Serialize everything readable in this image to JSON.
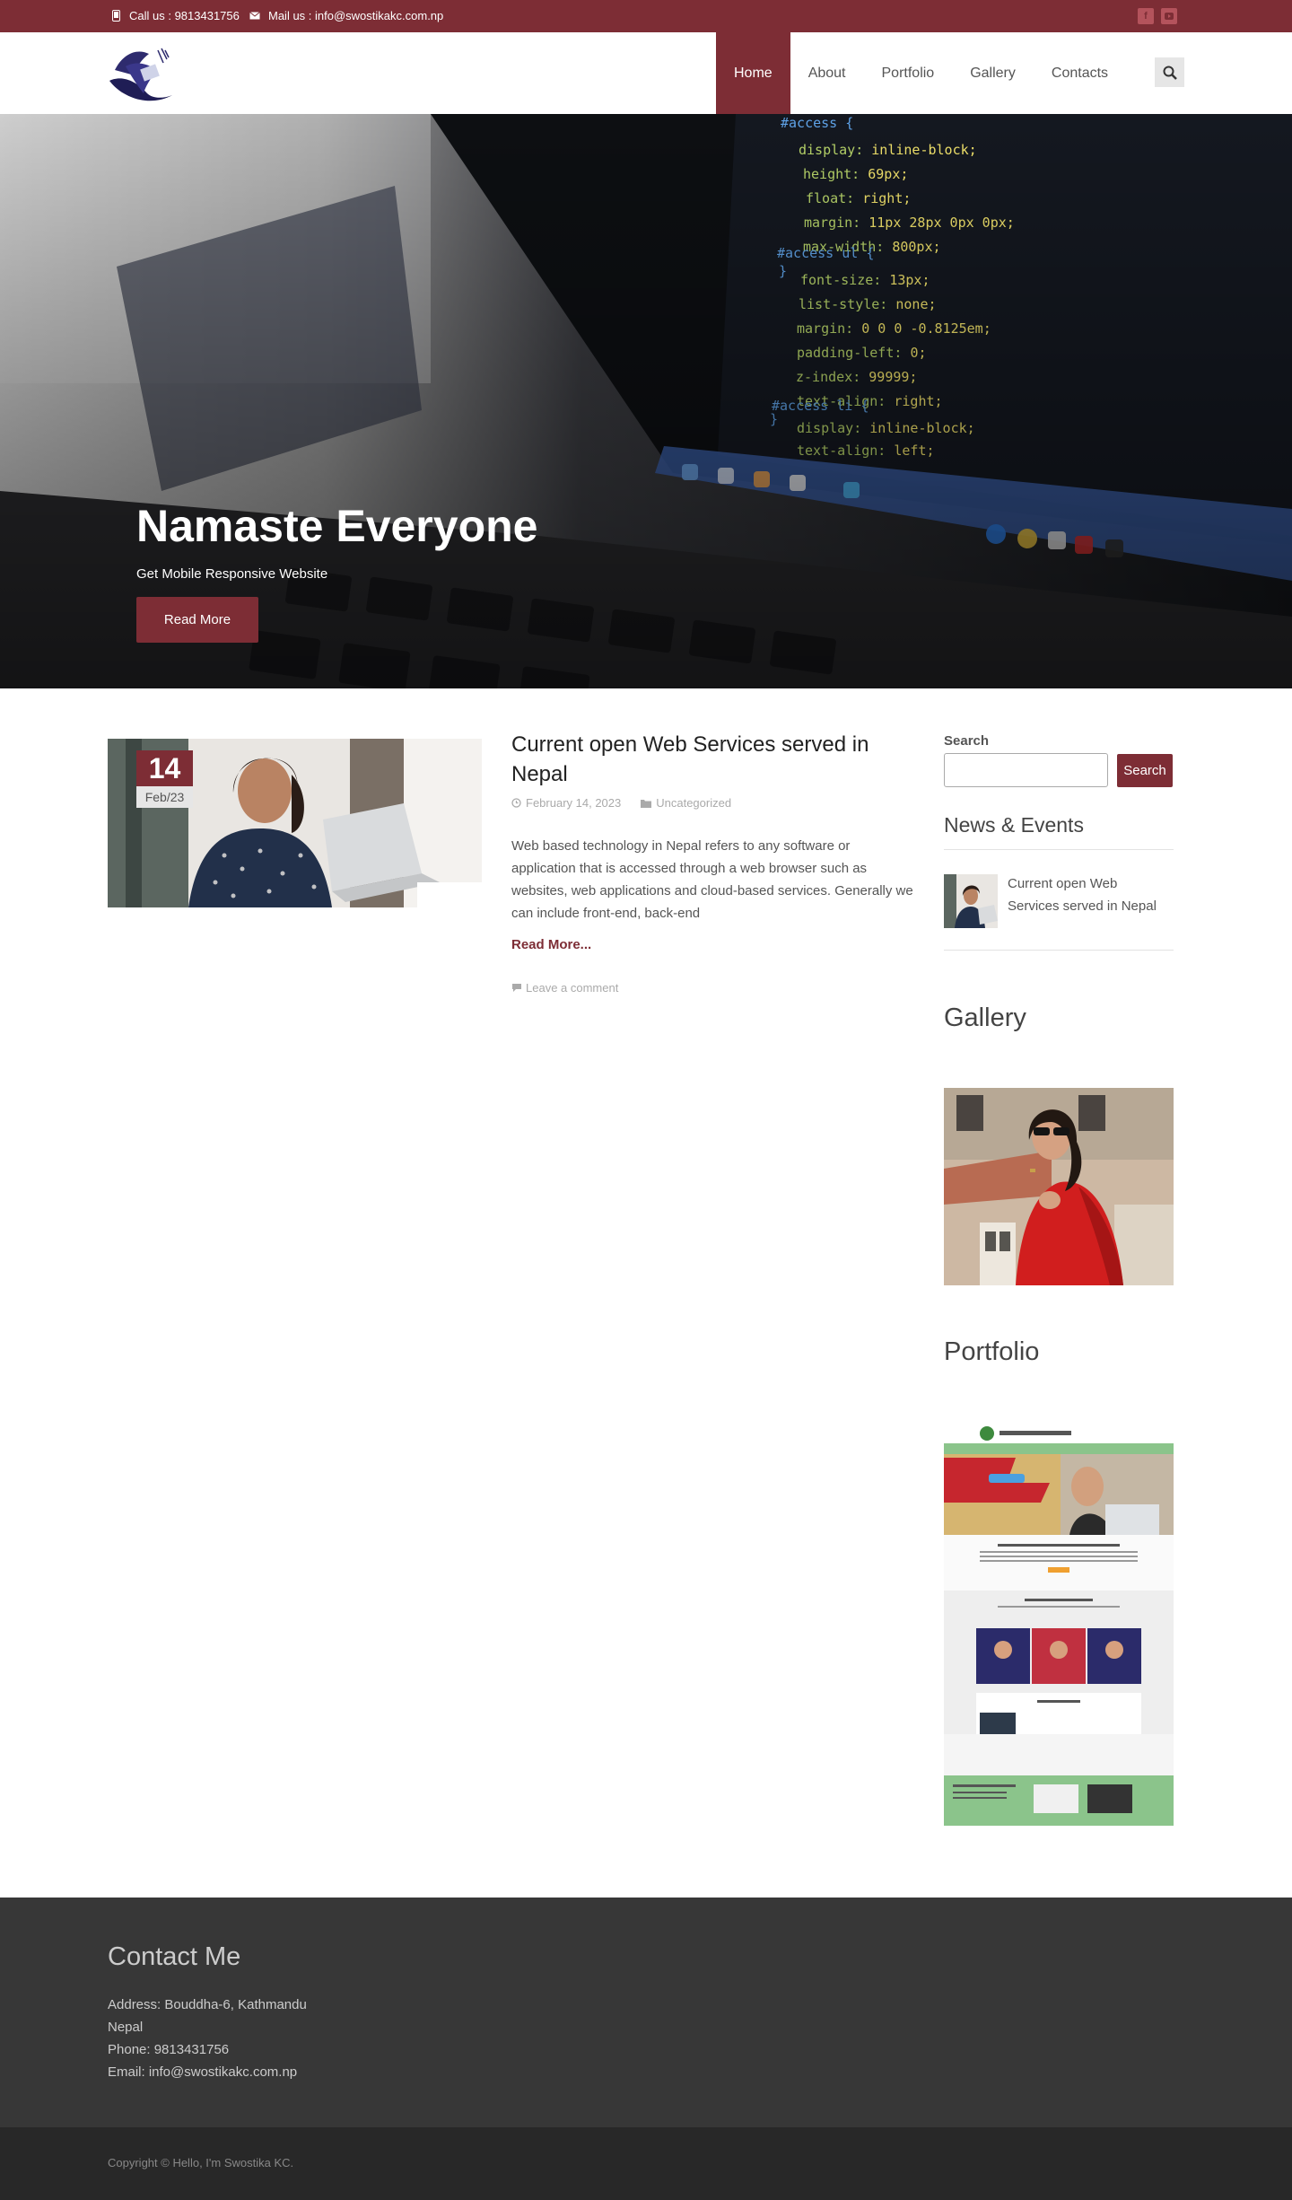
{
  "topbar": {
    "phone": "Call us : 9813431756",
    "mail": "Mail us : info@swostikakc.com.np",
    "social": [
      "facebook-icon",
      "youtube-icon"
    ]
  },
  "nav": {
    "items": [
      {
        "label": "Home",
        "active": true
      },
      {
        "label": "About"
      },
      {
        "label": "Portfolio"
      },
      {
        "label": "Gallery"
      },
      {
        "label": "Contacts"
      }
    ]
  },
  "hero": {
    "title": "Namaste Everyone",
    "subtitle": "Get Mobile Responsive Website",
    "button": "Read More"
  },
  "post": {
    "day": "14",
    "month": "Feb/23",
    "title": "Current open Web Services served in Nepal",
    "date": "February 14, 2023",
    "category": "Uncategorized",
    "excerpt": "Web based technology in Nepal refers to any software or application that is accessed through a web browser such as websites, web applications and cloud-based services. Generally we can include front-end, back-end",
    "read_more": "Read More...",
    "comment": "Leave a comment"
  },
  "sidebar": {
    "search_label": "Search",
    "search_button": "Search",
    "search_value": "",
    "news_title": "News & Events",
    "news_item": "Current open Web Services served in Nepal",
    "gallery_title": "Gallery",
    "portfolio_title": "Portfolio"
  },
  "footer": {
    "title": "Contact Me",
    "address_line1": "Address: Bouddha-6, Kathmandu",
    "address_line2": "Nepal",
    "phone": "Phone: 9813431756",
    "email": "Email: info@swostikakc.com.np",
    "copyright": "Copyright © Hello, I'm Swostika KC."
  },
  "colors": {
    "brand": "#7d2d35",
    "footer": "#373737",
    "bottom": "#282828"
  }
}
